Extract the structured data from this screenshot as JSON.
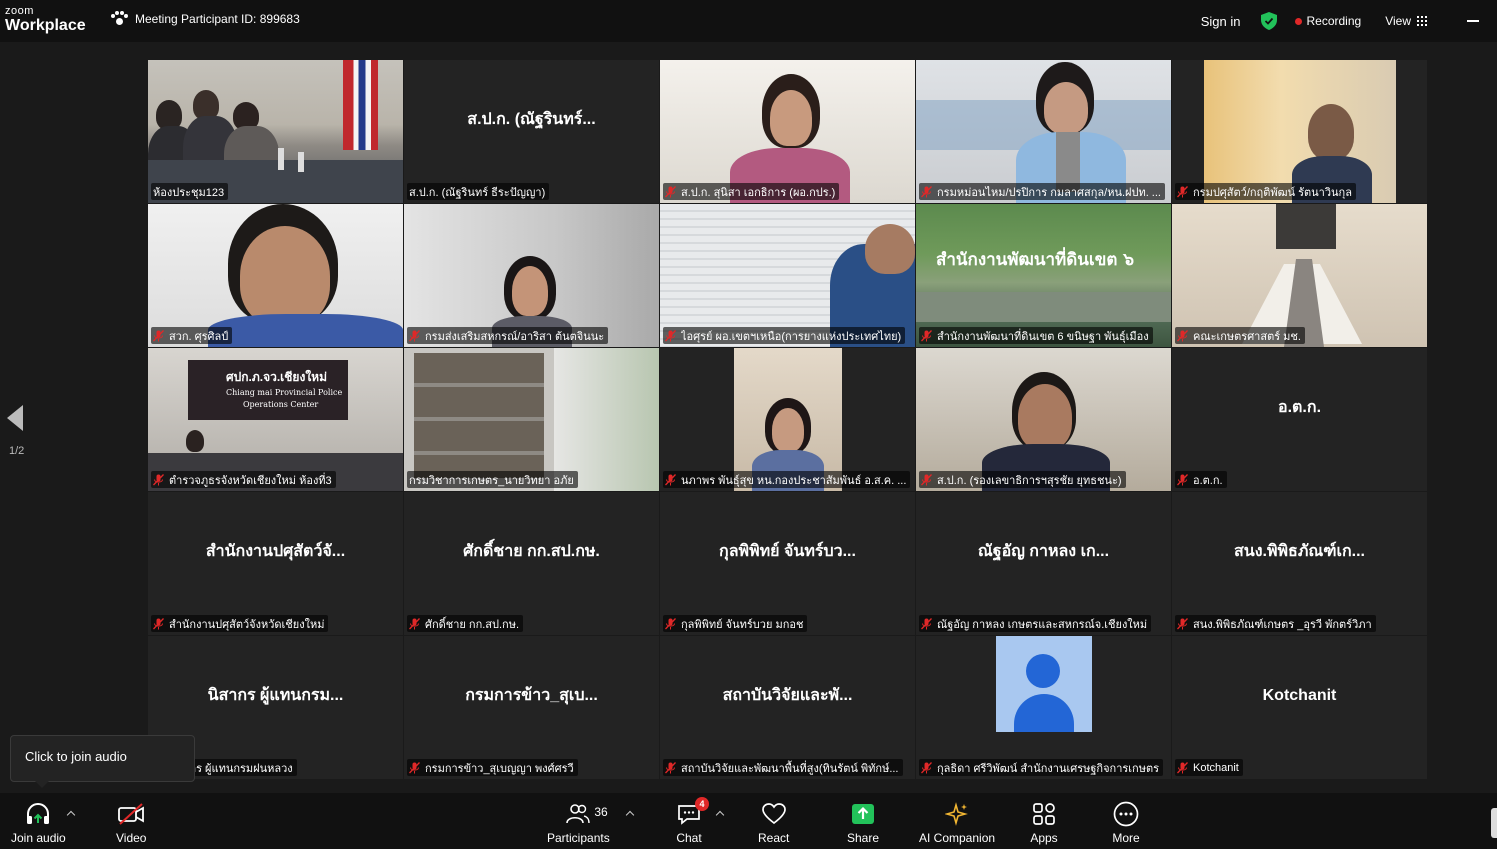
{
  "app": {
    "brand_small": "zoom",
    "brand_big": "Workplace"
  },
  "header": {
    "meeting_id": "Meeting Participant ID: 899683",
    "sign_in": "Sign in",
    "recording": "Recording",
    "view": "View"
  },
  "colors": {
    "active_speaker": "#22c25a",
    "recording": "#e02828",
    "shield": "#22c25a"
  },
  "page_indicator": "1/2",
  "tiles": [
    {
      "center": "",
      "label": "ห้องประชุม123",
      "muted": false
    },
    {
      "center": "ส.ป.ก. (ณัฐรินทร์...",
      "label": "ส.ป.ก. (ณัฐรินทร์ ธีระปัญญา)",
      "muted": false
    },
    {
      "center": "",
      "label": "ส.ป.ก. สุนิสา เอกธิการ (ผอ.กปร.)",
      "muted": true
    },
    {
      "center": "",
      "label": "กรมหม่อนไหม/ปรปิการ กมลาศสกุล/หน.ฝปท. ...",
      "muted": true
    },
    {
      "center": "",
      "label": "กรมปศุสัตว์/กฤติพัฒน์ รัตนาวินกุล",
      "muted": true
    },
    {
      "center": "",
      "label": "สวก. ศุรศิลป์",
      "muted": true
    },
    {
      "center": "",
      "label": "กรมส่งเสริมสหกรณ์/อาริสา ต้นตจินนะ",
      "muted": true
    },
    {
      "center": "",
      "label": "ไอศุรย์ ผอ.เขตฯเหนือ(การยางแห่งประเทศไทย)",
      "muted": true
    },
    {
      "center": "",
      "label": "สำนักงานพัฒนาที่ดินเขต 6 ขนิษฐา พันธุ์เมือง",
      "muted": true
    },
    {
      "center": "",
      "label": "คณะเกษตรศาสตร์ มช.",
      "muted": true
    },
    {
      "center": "",
      "label": "ตำรวจภูธรจังหวัดเชียงใหม่ ห้องที่3",
      "muted": true
    },
    {
      "center": "",
      "label": "กรมวิชาการเกษตร_นายวิทยา อภัย",
      "muted": false
    },
    {
      "center": "",
      "label": "นภาพร พันธุ์สุข หน.กองประชาสัมพันธ์ อ.ส.ค. ...",
      "muted": true
    },
    {
      "center": "",
      "label": "ส.ป.ก. (รองเลขาธิการฯสุรชัย ยุทธชนะ)",
      "muted": true
    },
    {
      "center": "อ.ต.ก.",
      "label": "อ.ต.ก.",
      "muted": true
    },
    {
      "center": "สำนักงานปศุสัตว์จั...",
      "label": "สำนักงานปศุสัตว์จังหวัดเชียงใหม่",
      "muted": true
    },
    {
      "center": "ศักดิ์ชาย กก.สป.กษ.",
      "label": "ศักดิ์ชาย กก.สป.กษ.",
      "muted": true
    },
    {
      "center": "กุลพิพิทย์ จันทร์บว...",
      "label": "กุลพิพิทย์ จันทร์บวย มกอช",
      "muted": true
    },
    {
      "center": "ณัฐอัญ  กาหลง เก...",
      "label": "ณัฐอัญ  กาหลง เกษตรและสหกรณ์จ.เชียงใหม่",
      "muted": true
    },
    {
      "center": "สนง.พิพิธภัณฑ์เก...",
      "label": "สนง.พิพิธภัณฑ์เกษตร _อุรวี พักตร์วิภา",
      "muted": true
    },
    {
      "center": "นิสากร ผู้แทนกรม...",
      "label": "นิสากร ผู้แทนกรมฝนหลวง",
      "muted": true
    },
    {
      "center": "กรมการข้าว_สุเบ...",
      "label": "กรมการข้าว_สุเบญญา พงศ์ศรวี",
      "muted": true
    },
    {
      "center": "สถาบันวิจัยและพั...",
      "label": "สถาบันวิจัยและพัฒนาพื้นที่สูง(ทินรัตน์ พิทักษ์...",
      "muted": true
    },
    {
      "center": "",
      "label": "กุลธิดา ศรีวิพัฒน์ สำนักงานเศรษฐกิจการเกษตร",
      "muted": true
    },
    {
      "center": "Kotchanit",
      "label": "Kotchanit",
      "muted": true
    }
  ],
  "scene_text": {
    "sign6": "สำนักงานพัฒนาที่ดินเขต ๖",
    "police_thai": "ศปก.ภ.จว.เชียงใหม่",
    "police_en1": "Chiang mai Provincial Police",
    "police_en2": "Operations Center"
  },
  "tooltip": "Click to join audio",
  "toolbar": {
    "join_audio": "Join audio",
    "video": "Video",
    "participants": "Participants",
    "participants_count": "36",
    "chat": "Chat",
    "chat_badge": "4",
    "react": "React",
    "share": "Share",
    "ai_companion": "AI Companion",
    "apps": "Apps",
    "more": "More"
  }
}
